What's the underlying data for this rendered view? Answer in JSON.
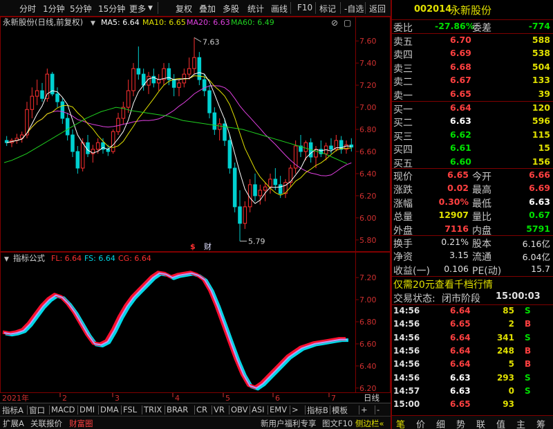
{
  "toolbar": {
    "items": [
      "分时",
      "1分钟",
      "5分钟",
      "15分钟",
      "更多",
      "复权",
      "叠加",
      "多股",
      "统计",
      "画线",
      "F10",
      "标记",
      "-自选",
      "返回"
    ]
  },
  "main_chart": {
    "header_title": "永新股份(日线,前复权)",
    "ma5": "MA5: 6.64",
    "ma10": "MA10: 6.65",
    "ma20": "MA20: 6.63",
    "ma60": "MA60: 6.49",
    "high_label": "7.63",
    "low_label": "5.79",
    "event_markers": [
      "$",
      "财"
    ],
    "colors": {
      "up": "#ff3030",
      "down": "#00d0d0",
      "ma5": "#ffffff",
      "ma10": "#e0e000",
      "ma20": "#e040e0",
      "ma60": "#20d020"
    }
  },
  "indicator": {
    "header_title": "指标公式",
    "fl": "FL: 6.64",
    "fs": "FS: 6.64",
    "cg": "CG: 6.64"
  },
  "x_axis": {
    "year_label": "2021年",
    "months": [
      "2",
      "3",
      "4",
      "5",
      "6",
      "7"
    ],
    "period_label": "日线"
  },
  "bottom_bar1": [
    "指标A",
    "窗口",
    "MACD",
    "DMI",
    "DMA",
    "FSL",
    "TRIX",
    "BRAR",
    "CR",
    "VR",
    "OBV",
    "ASI",
    "EMV",
    ">",
    "指标B",
    "模板",
    "+",
    "-"
  ],
  "bottom_bar2": {
    "left": [
      "扩展A",
      "关联报价",
      "财富圈"
    ],
    "right": [
      "新用户福利专享",
      "图文F10",
      "侧边栏«"
    ]
  },
  "chart_data": [
    {
      "type": "candlestick",
      "title": "永新股份(日线,前复权)",
      "y_ticks": [
        7.6,
        7.4,
        7.2,
        7.0,
        6.8,
        6.6,
        6.4,
        6.2,
        6.0,
        5.8
      ],
      "ylim": [
        5.73,
        7.72
      ],
      "x_months": [
        "2",
        "3",
        "4",
        "5",
        "6",
        "7"
      ],
      "ohlc": [
        [
          6.7,
          6.74,
          6.65,
          6.68
        ],
        [
          6.68,
          6.72,
          6.64,
          6.7
        ],
        [
          6.7,
          6.76,
          6.67,
          6.72
        ],
        [
          6.72,
          6.78,
          6.68,
          6.75
        ],
        [
          6.75,
          7.05,
          6.72,
          6.98
        ],
        [
          6.98,
          7.18,
          6.9,
          7.1
        ],
        [
          7.1,
          7.25,
          7.02,
          7.15
        ],
        [
          7.15,
          7.22,
          7.05,
          7.08
        ],
        [
          7.08,
          7.35,
          7.05,
          7.3
        ],
        [
          7.3,
          7.32,
          7.1,
          7.12
        ],
        [
          7.12,
          7.18,
          7.0,
          7.05
        ],
        [
          7.05,
          7.08,
          6.85,
          6.9
        ],
        [
          6.9,
          6.95,
          6.7,
          6.75
        ],
        [
          6.75,
          6.8,
          6.55,
          6.6
        ],
        [
          6.6,
          6.65,
          6.4,
          6.45
        ],
        [
          6.45,
          6.72,
          6.42,
          6.68
        ],
        [
          6.68,
          6.75,
          6.55,
          6.58
        ],
        [
          6.58,
          6.66,
          6.5,
          6.62
        ],
        [
          6.62,
          6.72,
          6.58,
          6.68
        ],
        [
          6.68,
          6.72,
          6.58,
          6.62
        ],
        [
          6.62,
          6.66,
          6.56,
          6.6
        ],
        [
          6.6,
          6.8,
          6.58,
          6.78
        ],
        [
          6.78,
          6.95,
          6.75,
          6.9
        ],
        [
          6.9,
          7.05,
          6.85,
          7.0
        ],
        [
          7.0,
          7.25,
          6.95,
          7.15
        ],
        [
          7.15,
          7.4,
          7.1,
          7.35
        ],
        [
          7.35,
          7.55,
          7.25,
          7.3
        ],
        [
          7.3,
          7.35,
          7.15,
          7.2
        ],
        [
          7.2,
          7.32,
          7.12,
          7.28
        ],
        [
          7.28,
          7.35,
          7.18,
          7.22
        ],
        [
          7.22,
          7.3,
          7.15,
          7.25
        ],
        [
          7.25,
          7.4,
          7.2,
          7.35
        ],
        [
          7.35,
          7.4,
          7.2,
          7.25
        ],
        [
          7.25,
          7.3,
          7.1,
          7.18
        ],
        [
          7.18,
          7.25,
          7.1,
          7.22
        ],
        [
          7.22,
          7.35,
          7.18,
          7.3
        ],
        [
          7.3,
          7.45,
          7.25,
          7.35
        ],
        [
          7.35,
          7.63,
          7.3,
          7.45
        ],
        [
          7.45,
          7.5,
          7.2,
          7.25
        ],
        [
          7.25,
          7.3,
          7.1,
          7.15
        ],
        [
          7.15,
          7.2,
          6.9,
          6.95
        ],
        [
          6.95,
          7.0,
          6.75,
          6.8
        ],
        [
          6.8,
          6.9,
          6.7,
          6.85
        ],
        [
          6.85,
          6.9,
          6.65,
          6.7
        ],
        [
          6.7,
          6.75,
          6.4,
          6.45
        ],
        [
          6.45,
          6.5,
          6.05,
          6.1
        ],
        [
          6.1,
          6.25,
          5.79,
          5.95
        ],
        [
          5.95,
          6.15,
          5.9,
          6.1
        ],
        [
          6.1,
          6.35,
          6.05,
          6.3
        ],
        [
          6.3,
          6.4,
          6.15,
          6.2
        ],
        [
          6.2,
          6.3,
          6.12,
          6.25
        ],
        [
          6.25,
          6.32,
          6.15,
          6.28
        ],
        [
          6.28,
          6.4,
          6.22,
          6.35
        ],
        [
          6.35,
          6.45,
          6.25,
          6.3
        ],
        [
          6.3,
          6.38,
          6.18,
          6.22
        ],
        [
          6.22,
          6.35,
          6.18,
          6.32
        ],
        [
          6.32,
          6.48,
          6.28,
          6.45
        ],
        [
          6.45,
          6.7,
          6.4,
          6.65
        ],
        [
          6.65,
          6.75,
          6.55,
          6.6
        ],
        [
          6.6,
          6.7,
          6.52,
          6.68
        ],
        [
          6.68,
          6.72,
          6.5,
          6.55
        ],
        [
          6.55,
          6.65,
          6.45,
          6.62
        ],
        [
          6.62,
          6.7,
          6.55,
          6.58
        ],
        [
          6.58,
          6.68,
          6.52,
          6.65
        ],
        [
          6.65,
          6.72,
          6.58,
          6.62
        ],
        [
          6.62,
          6.75,
          6.6,
          6.7
        ],
        [
          6.7,
          6.74,
          6.58,
          6.62
        ],
        [
          6.62,
          6.7,
          6.58,
          6.66
        ],
        [
          6.66,
          6.72,
          6.6,
          6.64
        ]
      ],
      "ma60": [
        6.5,
        6.52,
        6.55,
        6.58,
        6.62,
        6.66,
        6.7,
        6.74,
        6.78,
        6.82,
        6.86,
        6.9,
        6.93,
        6.96,
        6.98,
        7.0,
        6.99,
        6.97,
        6.96,
        6.95,
        6.94,
        6.93,
        6.92,
        6.9,
        6.88,
        6.87,
        6.86,
        6.85,
        6.84,
        6.83,
        6.82,
        6.81,
        6.8,
        6.78,
        6.76,
        6.74,
        6.72,
        6.7,
        6.68,
        6.66,
        6.64,
        6.62,
        6.6,
        6.58,
        6.55,
        6.52,
        6.49
      ]
    },
    {
      "type": "line",
      "title": "指标公式",
      "y_ticks": [
        7.2,
        7.0,
        6.8,
        6.6,
        6.4,
        6.2
      ],
      "ylim": [
        6.18,
        7.32
      ],
      "series": [
        {
          "name": "FL",
          "values": [
            6.7,
            6.69,
            6.7,
            6.72,
            6.78,
            6.86,
            6.94,
            7.0,
            7.04,
            7.02,
            6.96,
            6.88,
            6.78,
            6.68,
            6.6,
            6.59,
            6.62,
            6.72,
            6.84,
            6.94,
            7.02,
            7.08,
            7.14,
            7.2,
            7.24,
            7.23,
            7.2,
            7.22,
            7.23,
            7.24,
            7.22,
            7.18,
            7.08,
            6.94,
            6.78,
            6.62,
            6.46,
            6.32,
            6.22,
            6.2,
            6.24,
            6.3,
            6.36,
            6.42,
            6.48,
            6.52,
            6.56,
            6.58,
            6.6,
            6.61,
            6.62,
            6.63,
            6.64,
            6.64
          ]
        },
        {
          "name": "FS",
          "values": [
            6.7,
            6.69,
            6.7,
            6.72,
            6.78,
            6.86,
            6.94,
            7.0,
            7.04,
            7.02,
            6.96,
            6.88,
            6.78,
            6.68,
            6.6,
            6.59,
            6.62,
            6.72,
            6.84,
            6.94,
            7.02,
            7.08,
            7.14,
            7.2,
            7.24,
            7.23,
            7.2,
            7.22,
            7.23,
            7.24,
            7.22,
            7.18,
            7.08,
            6.94,
            6.78,
            6.62,
            6.46,
            6.32,
            6.22,
            6.2,
            6.24,
            6.3,
            6.36,
            6.42,
            6.48,
            6.52,
            6.56,
            6.58,
            6.6,
            6.61,
            6.62,
            6.63,
            6.64,
            6.64
          ]
        },
        {
          "name": "CG",
          "values": [
            6.7,
            6.69,
            6.7,
            6.72,
            6.78,
            6.86,
            6.94,
            7.0,
            7.04,
            7.02,
            6.96,
            6.88,
            6.78,
            6.68,
            6.6,
            6.59,
            6.62,
            6.72,
            6.84,
            6.94,
            7.02,
            7.08,
            7.14,
            7.2,
            7.24,
            7.23,
            7.2,
            7.22,
            7.23,
            7.24,
            7.22,
            7.18,
            7.08,
            6.94,
            6.78,
            6.62,
            6.46,
            6.32,
            6.22,
            6.2,
            6.24,
            6.3,
            6.36,
            6.42,
            6.48,
            6.52,
            6.56,
            6.58,
            6.6,
            6.61,
            6.62,
            6.63,
            6.64,
            6.64
          ]
        }
      ]
    }
  ],
  "quote": {
    "code": "002014",
    "name": "永新股份",
    "weibi_label": "委比",
    "weibi": "-27.86%",
    "weicha_label": "委差",
    "weicha": "-774",
    "sell": [
      {
        "label": "卖五",
        "price": "6.70",
        "vol": "588"
      },
      {
        "label": "卖四",
        "price": "6.69",
        "vol": "538"
      },
      {
        "label": "卖三",
        "price": "6.68",
        "vol": "504"
      },
      {
        "label": "卖二",
        "price": "6.67",
        "vol": "133"
      },
      {
        "label": "卖一",
        "price": "6.65",
        "vol": "39"
      }
    ],
    "buy": [
      {
        "label": "买一",
        "price": "6.64",
        "vol": "120"
      },
      {
        "label": "买二",
        "price": "6.63",
        "vol": "596"
      },
      {
        "label": "买三",
        "price": "6.62",
        "vol": "115"
      },
      {
        "label": "买四",
        "price": "6.61",
        "vol": "15"
      },
      {
        "label": "买五",
        "price": "6.60",
        "vol": "156"
      }
    ],
    "stats": [
      {
        "l1": "现价",
        "v1": "6.65",
        "l2": "今开",
        "v2": "6.66"
      },
      {
        "l1": "涨跌",
        "v1": "0.02",
        "l2": "最高",
        "v2": "6.69"
      },
      {
        "l1": "涨幅",
        "v1": "0.30%",
        "l2": "最低",
        "v2": "6.63"
      },
      {
        "l1": "总量",
        "v1": "12907",
        "l2": "量比",
        "v2": "0.67"
      },
      {
        "l1": "外盘",
        "v1": "7116",
        "l2": "内盘",
        "v2": "5791"
      }
    ],
    "fin": [
      {
        "l1": "换手",
        "v1": "0.21%",
        "l2": "股本",
        "v2": "6.16亿"
      },
      {
        "l1": "净资",
        "v1": "3.15",
        "l2": "流通",
        "v2": "6.04亿"
      },
      {
        "l1": "收益(一)",
        "v1": "0.106",
        "l2": "PE(动)",
        "v2": "15.7"
      }
    ],
    "promo": "仅需20元查看千档行情",
    "status_label": "交易状态:",
    "status": "闭市阶段",
    "status_time": "15:00:03",
    "ticks": [
      {
        "time": "14:56",
        "price": "6.64",
        "vol": "85",
        "side": "S"
      },
      {
        "time": "14:56",
        "price": "6.65",
        "vol": "2",
        "side": "B"
      },
      {
        "time": "14:56",
        "price": "6.64",
        "vol": "341",
        "side": "S"
      },
      {
        "time": "14:56",
        "price": "6.64",
        "vol": "248",
        "side": "B"
      },
      {
        "time": "14:56",
        "price": "6.64",
        "vol": "5",
        "side": "B"
      },
      {
        "time": "14:56",
        "price": "6.63",
        "vol": "293",
        "side": "S"
      },
      {
        "time": "14:57",
        "price": "6.63",
        "vol": "0",
        "side": "S"
      },
      {
        "time": "15:00",
        "price": "6.65",
        "vol": "93",
        "side": ""
      }
    ],
    "tabs": [
      "笔",
      "价",
      "细",
      "势",
      "联",
      "值",
      "主",
      "筹"
    ]
  }
}
